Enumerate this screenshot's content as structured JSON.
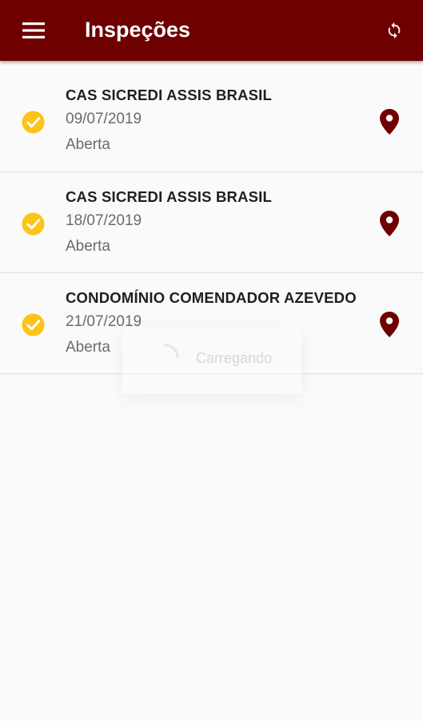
{
  "app_bar": {
    "title": "Inspeções",
    "menu_icon": "menu-icon",
    "sync_icon": "sync-icon",
    "color": "#6e0000"
  },
  "inspections": [
    {
      "name": "CAS SICREDI ASSIS BRASIL",
      "date": "09/07/2019",
      "status": "Aberta",
      "status_icon": "check-circle-icon",
      "location_icon": "map-pin-icon"
    },
    {
      "name": "CAS SICREDI ASSIS BRASIL",
      "date": "18/07/2019",
      "status": "Aberta",
      "status_icon": "check-circle-icon",
      "location_icon": "map-pin-icon"
    },
    {
      "name": "CONDOMÍNIO COMENDADOR AZEVEDO",
      "date": "21/07/2019",
      "status": "Aberta",
      "status_icon": "check-circle-icon",
      "location_icon": "map-pin-icon"
    }
  ],
  "loading_dialog": {
    "text": "Carregando"
  },
  "colors": {
    "check": "#fcc419",
    "pin": "#6e0000"
  }
}
